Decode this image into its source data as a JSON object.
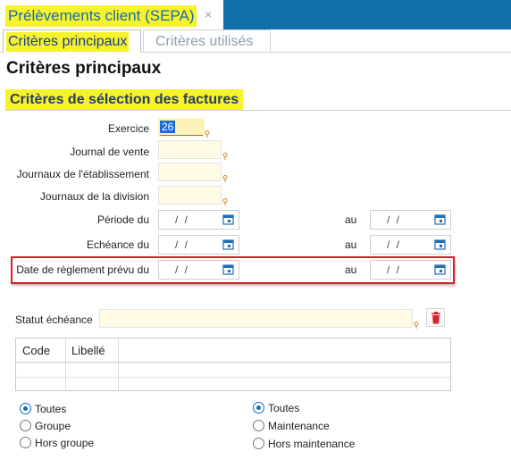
{
  "window": {
    "title": "Prélèvements client (SEPA)",
    "close_glyph": "×"
  },
  "tabs": [
    "Critères principaux",
    "Critères utilisés"
  ],
  "page_title": "Critères principaux",
  "section_title": "Critères de sélection des factures",
  "fields": {
    "exercice": {
      "label": "Exercice",
      "value": "26"
    },
    "journal_vente": {
      "label": "Journal de vente",
      "value": ""
    },
    "journaux_etab": {
      "label": "Journaux de l'établissement",
      "value": ""
    },
    "journaux_div": {
      "label": "Journaux de la division",
      "value": ""
    },
    "periode": {
      "label": "Période du",
      "to_label": "au",
      "from": "/ /",
      "to": "/ /"
    },
    "echeance": {
      "label": "Echéance du",
      "to_label": "au",
      "from": "/ /",
      "to": "/ /"
    },
    "reglement": {
      "label": "Date de règlement prévu du",
      "to_label": "au",
      "from": "/ /",
      "to": "/ /"
    },
    "statut": {
      "label": "Statut échéance",
      "value": ""
    }
  },
  "grid": {
    "columns": [
      "Code",
      "Libellé"
    ],
    "rows": []
  },
  "radio_left": {
    "options": [
      "Toutes",
      "Groupe",
      "Hors groupe"
    ],
    "selected": "Toutes"
  },
  "radio_right": {
    "options": [
      "Toutes",
      "Maintenance",
      "Hors maintenance"
    ],
    "selected": "Toutes"
  },
  "colors": {
    "accent": "#0f70a8",
    "highlight": "#f6f32d",
    "input_bg": "#fffbe5",
    "alert_border": "#d61f27",
    "radio": "#0f6cbd"
  },
  "icons": {
    "close": "close-icon",
    "calendar": "calendar-icon",
    "lookup": "lookup-pin-icon",
    "delete": "trash-icon"
  }
}
